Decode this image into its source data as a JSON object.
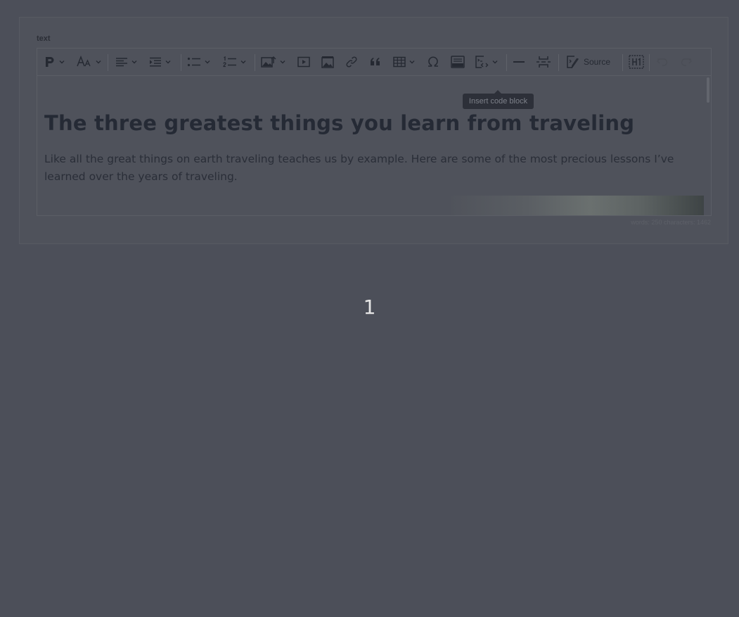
{
  "field": {
    "label": "text"
  },
  "toolbar": {
    "paragraph_icon": "paragraph-icon",
    "font_size_icon": "font-size-icon",
    "align_icon": "align-left-icon",
    "indent_icon": "indent-icon",
    "bulleted_list_icon": "bulleted-list-icon",
    "numbered_list_icon": "numbered-list-icon",
    "image_upload_icon": "image-upload-icon",
    "media_icon": "media-embed-icon",
    "image_icon": "image-icon",
    "link_icon": "link-icon",
    "quote_icon": "block-quote-icon",
    "table_icon": "table-icon",
    "special_chars_icon": "omega-icon",
    "html_embed_icon": "html-embed-icon",
    "code_block_icon": "code-block-icon",
    "horizontal_line_icon": "horizontal-line-icon",
    "page_break_icon": "page-break-icon",
    "source_label": "Source",
    "heading_icon": "h1-icon",
    "undo_icon": "undo-icon",
    "redo_icon": "redo-icon"
  },
  "tooltip": {
    "text": "Insert code block"
  },
  "document": {
    "title": "The three greatest things you learn from traveling",
    "paragraph": "Like all the great things on earth traveling teaches us by example. Here are some of the most precious lessons I’ve learned over the years of traveling."
  },
  "status": {
    "wordcount": "words: 250  characters: 1462"
  },
  "page": {
    "number": "1"
  }
}
